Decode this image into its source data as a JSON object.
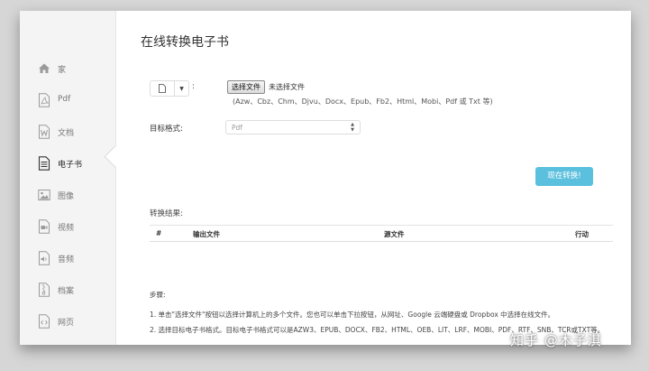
{
  "sidebar": {
    "items": [
      {
        "label": "家",
        "icon": "home-icon"
      },
      {
        "label": "Pdf",
        "icon": "pdf-file-icon"
      },
      {
        "label": "文档",
        "icon": "word-file-icon"
      },
      {
        "label": "电子书",
        "icon": "ebook-icon",
        "active": true
      },
      {
        "label": "图像",
        "icon": "image-icon"
      },
      {
        "label": "视频",
        "icon": "video-file-icon"
      },
      {
        "label": "音频",
        "icon": "audio-file-icon"
      },
      {
        "label": "档案",
        "icon": "archive-file-icon"
      },
      {
        "label": "网页",
        "icon": "code-file-icon"
      }
    ]
  },
  "main": {
    "title": "在线转换电子书",
    "upload": {
      "colon": ":",
      "choose_file_label": "选择文件",
      "no_file_text": "未选择文件",
      "supported_formats": "(Azw、Cbz、Chm、Djvu、Docx、Epub、Fb2、Html、Mobi、Pdf 或 Txt 等)"
    },
    "target_format": {
      "label": "目标格式:",
      "selected": "Pdf"
    },
    "convert_button": "现在转换!",
    "results": {
      "label": "转换结果:",
      "columns": [
        "#",
        "输出文件",
        "源文件",
        "行动"
      ]
    },
    "steps": {
      "label": "步骤:",
      "items": [
        "1. 单击\"选择文件\"按钮以选择计算机上的多个文件。您也可以单击下拉按钮，从网址、Google 云端硬盘或 Dropbox 中选择在线文件。",
        "2. 选择目标电子书格式。目标电子书格式可以是AZW3、EPUB、DOCX、FB2、HTML、OEB、LIT、LRF、MOBI、PDF、RTF、SNB、TCR或TXT等。"
      ]
    }
  },
  "watermark": "知乎 @木子淇",
  "colors": {
    "accent": "#5bc0de",
    "sidebar_bg": "#f4f4f4",
    "icon": "#9a9a9a"
  }
}
